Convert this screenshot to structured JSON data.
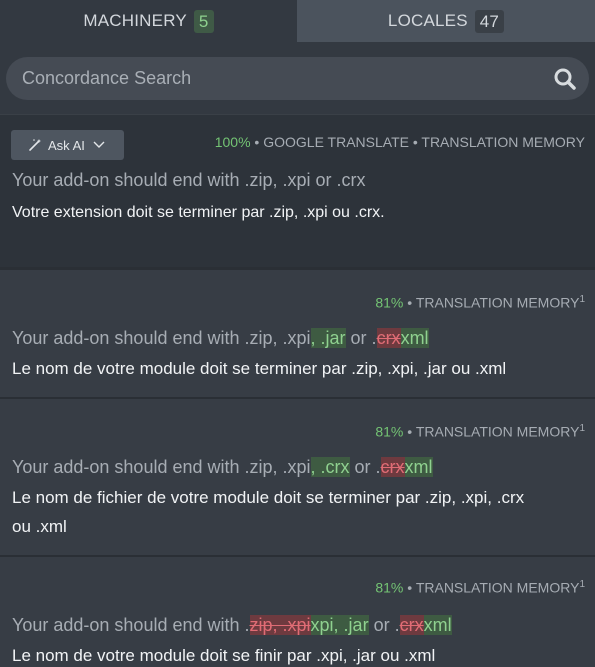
{
  "tabs": {
    "machinery": {
      "label": "MACHINERY",
      "count": "5"
    },
    "locales": {
      "label": "LOCALES",
      "count": "47"
    }
  },
  "search": {
    "placeholder": "Concordance Search"
  },
  "entries": [
    {
      "ask_ai": "Ask AI",
      "score": "100%",
      "sources": "GOOGLE TRANSLATE • TRANSLATION MEMORY",
      "source_text": "Your add-on should end with .zip, .xpi or .crx",
      "translation": "Votre extension doit se terminer par .zip, .xpi ou .crx."
    },
    {
      "score": "81%",
      "sources": "TRANSLATION MEMORY",
      "sup": "1",
      "source_parts": {
        "a": "Your add-on should end with .zip, .xpi",
        "ins1": ", .jar",
        "b": " or .",
        "del1": "crx",
        "ins2": "xml"
      },
      "translation": "Le nom de votre module doit se terminer par .zip, .xpi, .jar ou .xml"
    },
    {
      "score": "81%",
      "sources": "TRANSLATION MEMORY",
      "sup": "1",
      "source_parts": {
        "a": "Your add-on should end with .zip, .xpi",
        "ins1": ", .crx",
        "b": " or .",
        "del1": "crx",
        "ins2": "xml"
      },
      "translation_line1": "Le nom de fichier de votre module doit se terminer par .zip, .xpi, .crx",
      "translation_line2": "ou .xml"
    },
    {
      "score": "81%",
      "sources": "TRANSLATION MEMORY",
      "sup": "1",
      "source_parts": {
        "a": "Your add-on should end with .",
        "del1": "zip, .xpi",
        "ins1": "xpi, .jar",
        "b": " or .",
        "del2": "crx",
        "ins2": "xml"
      },
      "translation": "Le nom de votre module doit se finir par .xpi, .jar ou .xml"
    }
  ],
  "colors": {
    "insert_bg": "#3e5b42",
    "delete_bg": "#6e3a3f",
    "score_green": "#74c474"
  }
}
